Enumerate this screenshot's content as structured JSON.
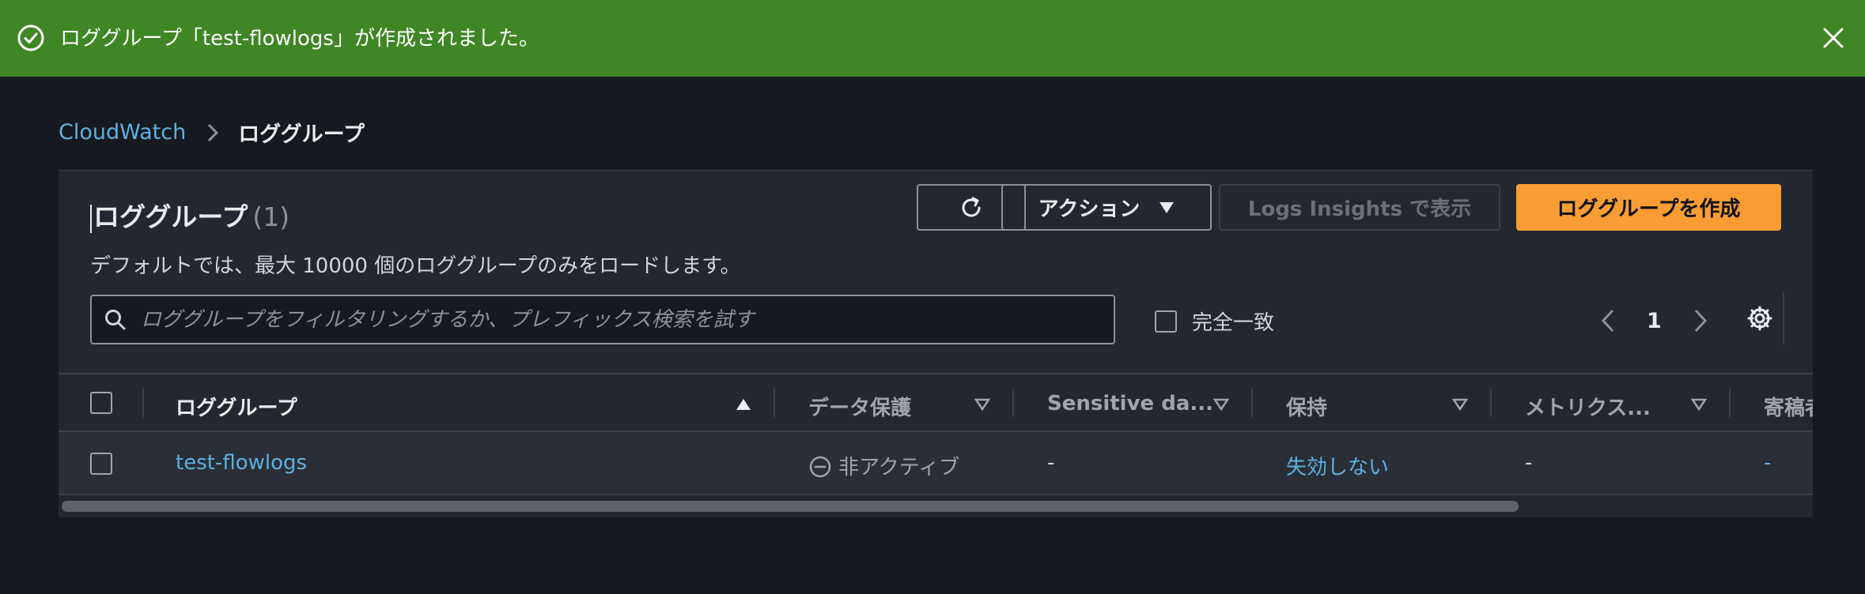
{
  "flash": {
    "message": "ロググループ「test-flowlogs」が作成されました。"
  },
  "breadcrumb": {
    "root": "CloudWatch",
    "current": "ロググループ"
  },
  "panel": {
    "title": "ロググループ",
    "count": "(1)",
    "description": "デフォルトでは、最大 10000 個のロググループのみをロードします。",
    "buttons": {
      "actions": "アクション",
      "insights": "Logs Insights で表示",
      "create": "ロググループを作成"
    },
    "search": {
      "placeholder": "ロググループをフィルタリングするか、プレフィックス検索を試す",
      "value": ""
    },
    "exact_match_label": "完全一致",
    "pagination": {
      "page": "1"
    }
  },
  "table": {
    "columns": [
      "ロググループ",
      "データ保護",
      "Sensitive da...",
      "保持",
      "メトリクス...",
      "寄稿者"
    ],
    "rows": [
      {
        "name": "test-flowlogs",
        "data_protection": "非アクティブ",
        "sensitive": "-",
        "retention": "失効しない",
        "metrics": "-",
        "contributors": "-"
      }
    ]
  }
}
